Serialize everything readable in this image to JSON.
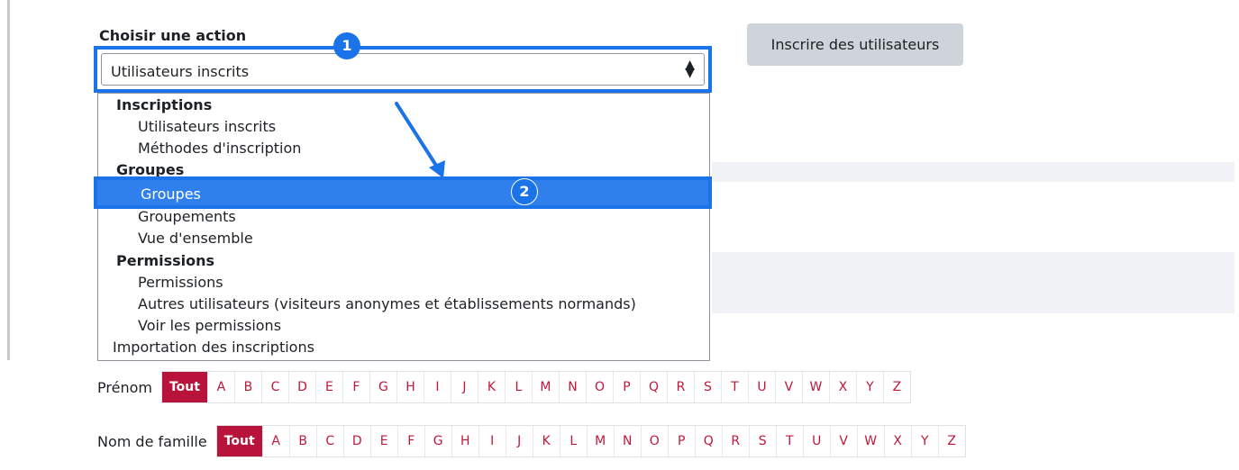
{
  "form": {
    "label": "Choisir une action",
    "selected_value": "Utilisateurs inscrits",
    "arrows": "⇕"
  },
  "enrol_button": {
    "label": "Inscrire des utilisateurs"
  },
  "badges": {
    "one": "1",
    "two": "2"
  },
  "dropdown": {
    "group_inscriptions": "Inscriptions",
    "item_users": "Utilisateurs inscrits",
    "item_methods": "Méthodes d'inscription",
    "group_groupes": "Groupes",
    "item_groupes": "Groupes",
    "item_groupements": "Groupements",
    "item_overview": "Vue d'ensemble",
    "group_permissions": "Permissions",
    "item_permissions": "Permissions",
    "item_other_users": "Autres utilisateurs (visiteurs anonymes et établissements normands)",
    "item_check_permissions": "Voir les permissions",
    "item_import": "Importation des inscriptions"
  },
  "filters": {
    "first_name_label": "Prénom",
    "last_name_label": "Nom de famille",
    "all_label": "Tout",
    "letters": [
      "A",
      "B",
      "C",
      "D",
      "E",
      "F",
      "G",
      "H",
      "I",
      "J",
      "K",
      "L",
      "M",
      "N",
      "O",
      "P",
      "Q",
      "R",
      "S",
      "T",
      "U",
      "V",
      "W",
      "X",
      "Y",
      "Z"
    ]
  },
  "colors": {
    "accent": "#1a73e8",
    "active_filter": "#b8133a",
    "link": "#c0183c"
  }
}
